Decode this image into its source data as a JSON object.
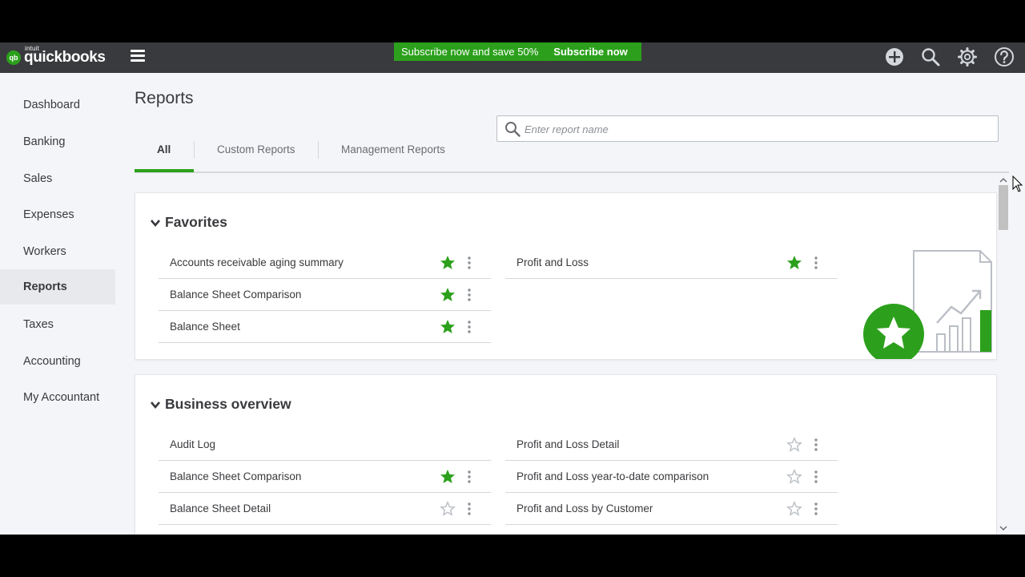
{
  "brand": {
    "intuit": "intuit",
    "product": "quickbooks",
    "mark": "qb",
    "accent": "#2ca01c"
  },
  "promo": {
    "text": "Subscribe now and save 50%",
    "button": "Subscribe now"
  },
  "header_icons": [
    "plus-icon",
    "search-icon",
    "gear-icon",
    "help-icon"
  ],
  "sidebar": {
    "items": [
      {
        "label": "Dashboard",
        "active": false
      },
      {
        "label": "Banking",
        "active": false
      },
      {
        "label": "Sales",
        "active": false
      },
      {
        "label": "Expenses",
        "active": false
      },
      {
        "label": "Workers",
        "active": false
      },
      {
        "label": "Reports",
        "active": true
      },
      {
        "label": "Taxes",
        "active": false
      },
      {
        "label": "Accounting",
        "active": false
      },
      {
        "label": "My Accountant",
        "active": false
      }
    ]
  },
  "page": {
    "title": "Reports"
  },
  "tabs": [
    {
      "label": "All",
      "active": true
    },
    {
      "label": "Custom Reports",
      "active": false
    },
    {
      "label": "Management Reports",
      "active": false
    }
  ],
  "search": {
    "placeholder": "Enter report name",
    "value": ""
  },
  "favorites": {
    "title": "Favorites",
    "left": [
      {
        "label": "Accounts receivable aging summary",
        "starred": true
      },
      {
        "label": "Balance Sheet Comparison",
        "starred": true
      },
      {
        "label": "Balance Sheet",
        "starred": true
      }
    ],
    "right": [
      {
        "label": "Profit and Loss",
        "starred": true
      }
    ]
  },
  "business_overview": {
    "title": "Business overview",
    "left": [
      {
        "label": "Audit Log",
        "starred": null
      },
      {
        "label": "Balance Sheet Comparison",
        "starred": true
      },
      {
        "label": "Balance Sheet Detail",
        "starred": false
      }
    ],
    "right": [
      {
        "label": "Profit and Loss Detail",
        "starred": false
      },
      {
        "label": "Profit and Loss year-to-date comparison",
        "starred": false
      },
      {
        "label": "Profit and Loss by Customer",
        "starred": false
      }
    ]
  }
}
